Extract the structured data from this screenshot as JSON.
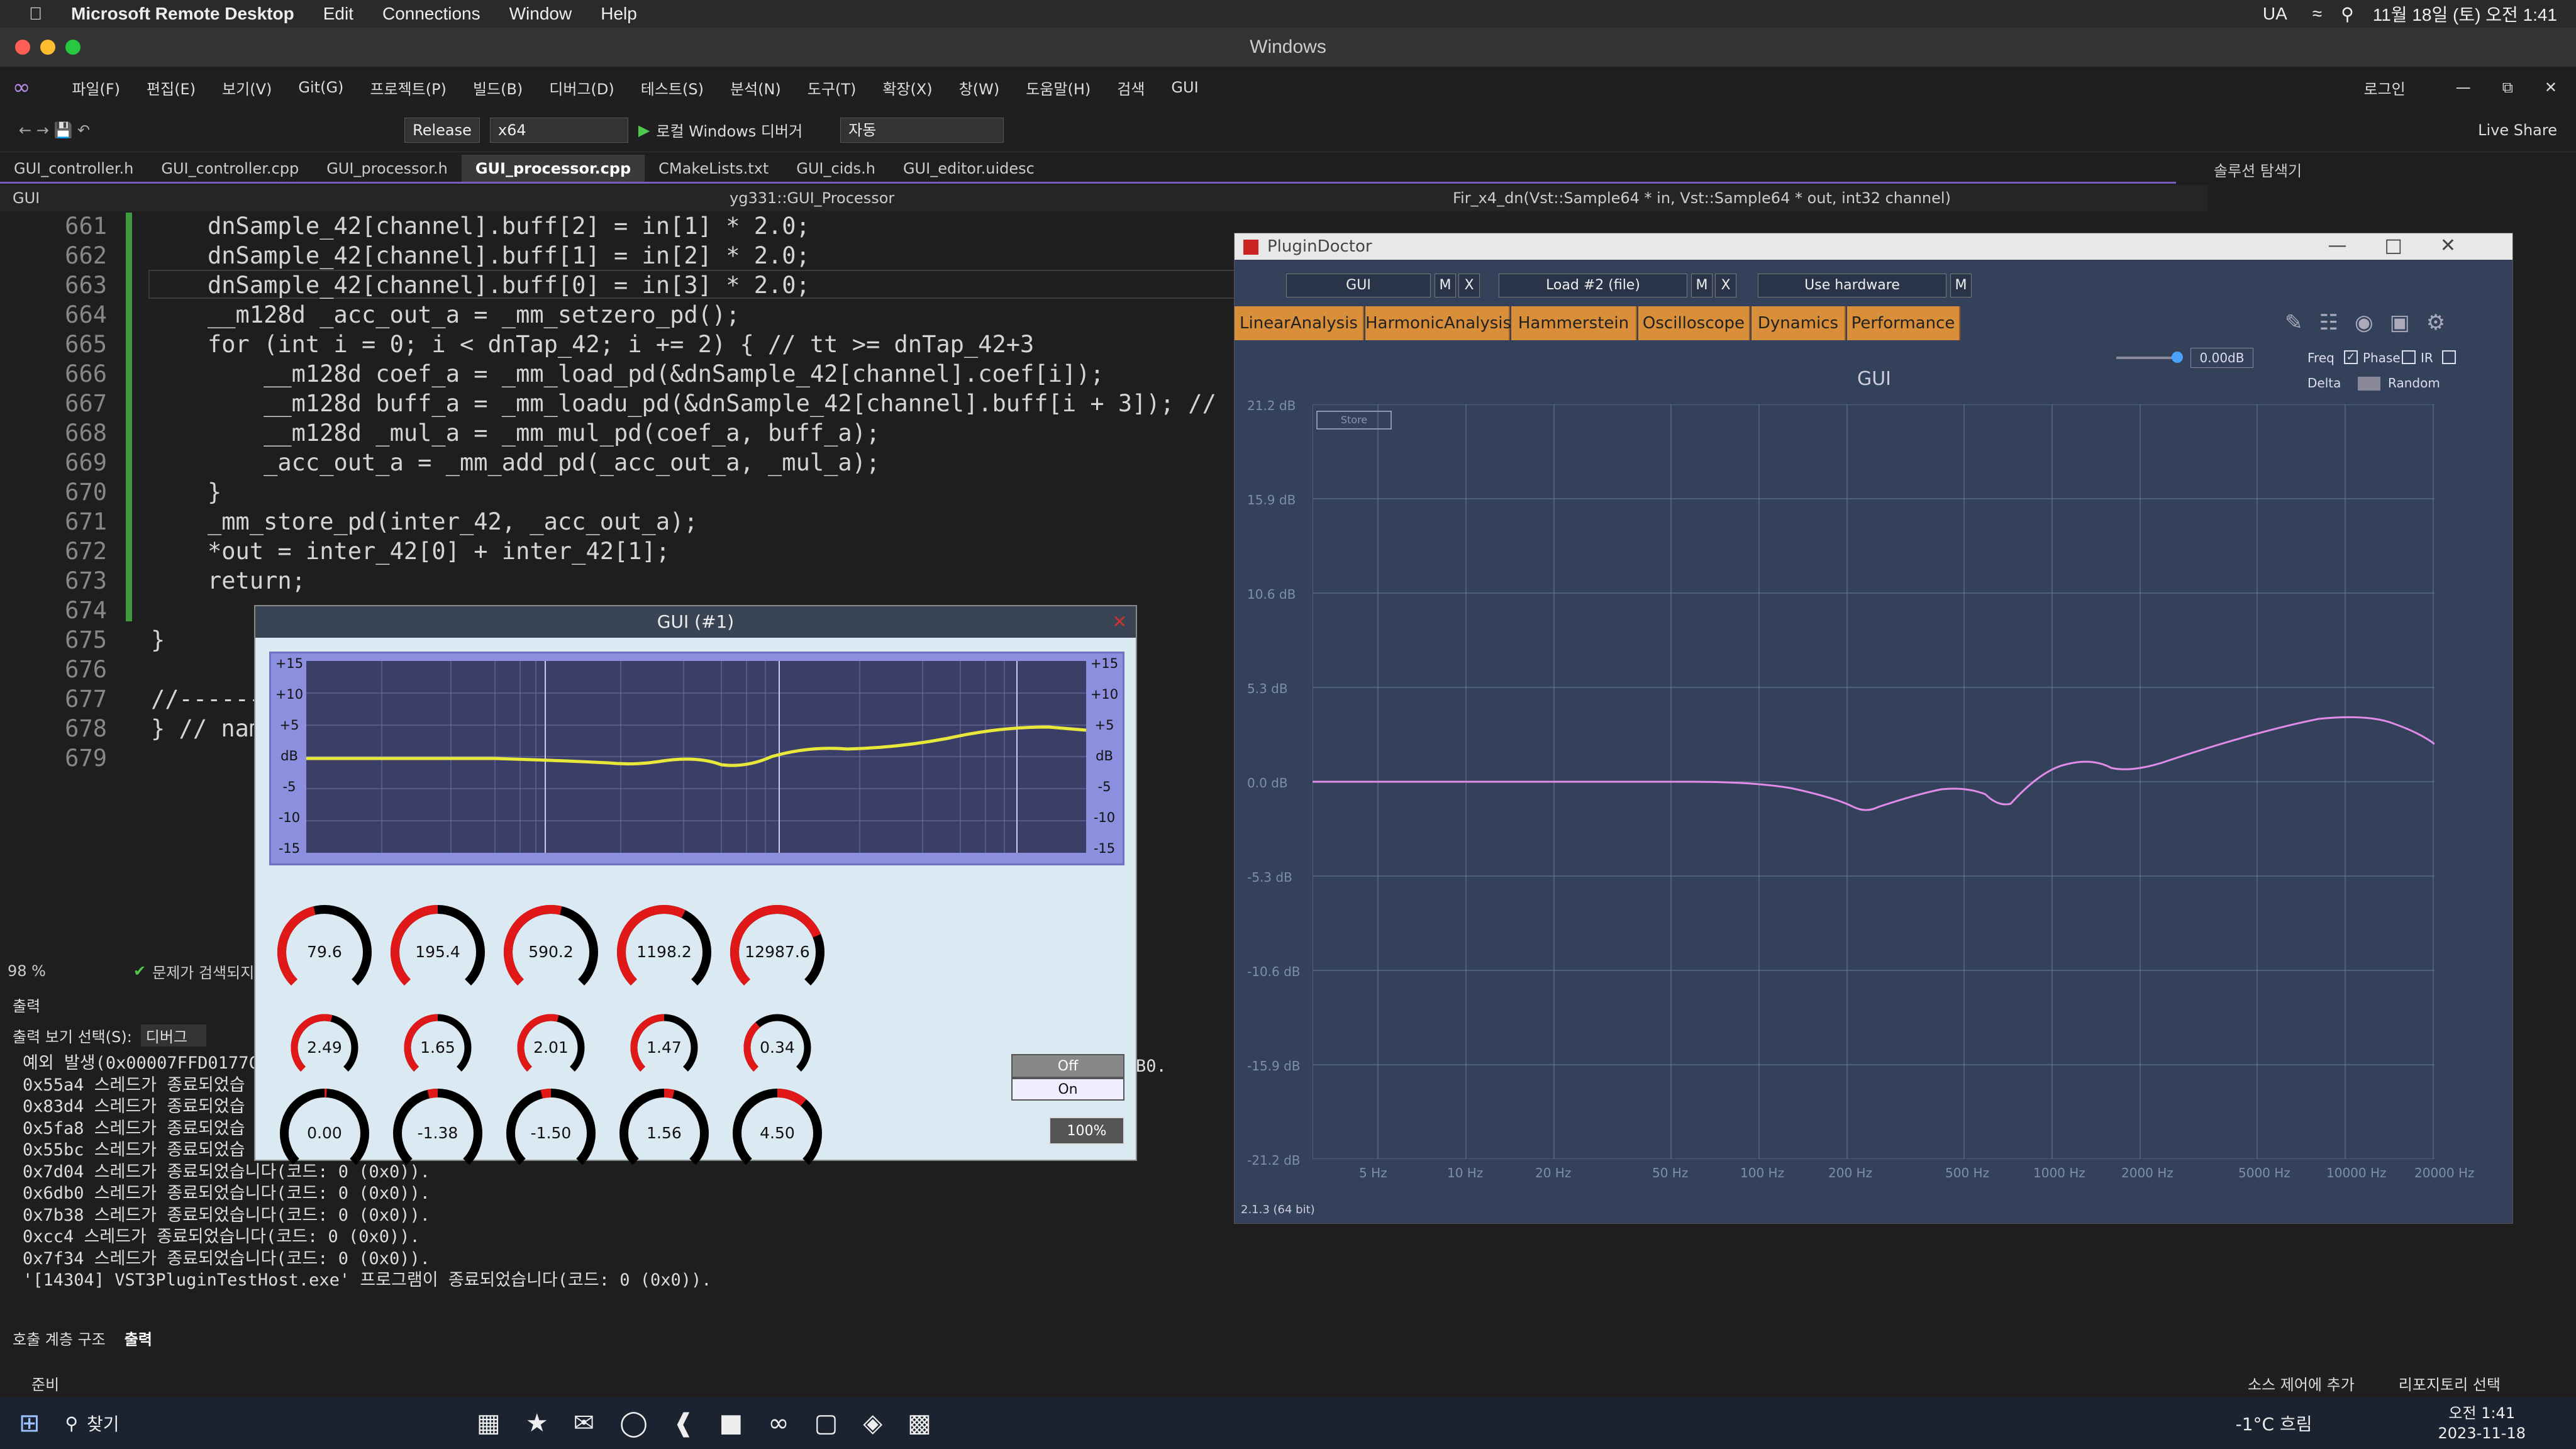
{
  "mac_menu": {
    "app": "Microsoft Remote Desktop",
    "items": [
      "Edit",
      "Connections",
      "Window",
      "Help"
    ],
    "right": [
      "UA",
      "11월 18일 (토) 오전 1:41"
    ]
  },
  "rd_title": "Windows",
  "vs_menu": [
    "파일(F)",
    "편집(E)",
    "보기(V)",
    "Git(G)",
    "프로젝트(P)",
    "빌드(B)",
    "디버그(D)",
    "테스트(S)",
    "분석(N)",
    "도구(T)",
    "확장(X)",
    "창(W)",
    "도움말(H)",
    "검색",
    "GUI"
  ],
  "vs_right": {
    "login": "로그인",
    "liveshare": "Live Share"
  },
  "toolbar": {
    "config": "Release",
    "platform": "x64",
    "debugger": "로컬 Windows 디버거",
    "auto": "자동"
  },
  "tabs": [
    "GUI_controller.h",
    "GUI_controller.cpp",
    "GUI_processor.h",
    "GUI_processor.cpp",
    "CMakeLists.txt",
    "GUI_cids.h",
    "GUI_editor.uidesc"
  ],
  "crumb": {
    "project": "GUI",
    "scope": "yg331::GUI_Processor",
    "func": "Fir_x4_dn(Vst::Sample64 * in, Vst::Sample64 * out, int32 channel)"
  },
  "solution_explorer": "솔루션 탐색기",
  "code_lines": [
    {
      "n": "661",
      "t": "dnSample_42[channel].buff[2] = in[1] * 2.0;"
    },
    {
      "n": "662",
      "t": "dnSample_42[channel].buff[1] = in[2] * 2.0;"
    },
    {
      "n": "663",
      "t": "dnSample_42[channel].buff[0] = in[3] * 2.0;"
    },
    {
      "n": "664",
      "t": "__m128d _acc_out_a = _mm_setzero_pd();"
    },
    {
      "n": "665",
      "t": "for (int i = 0; i < dnTap_42; i += 2) { // tt >= dnTap_42+3"
    },
    {
      "n": "666",
      "t": "    __m128d coef_a = _mm_load_pd(&dnSample_42[channel].coef[i]);"
    },
    {
      "n": "667",
      "t": "    __m128d buff_a = _mm_loadu_pd(&dnSample_42[channel].buff[i + 3]); //"
    },
    {
      "n": "668",
      "t": "    __m128d _mul_a = _mm_mul_pd(coef_a, buff_a);"
    },
    {
      "n": "669",
      "t": "    _acc_out_a = _mm_add_pd(_acc_out_a, _mul_a);"
    },
    {
      "n": "670",
      "t": "}"
    },
    {
      "n": "671",
      "t": "_mm_store_pd(inter_42, _acc_out_a);"
    },
    {
      "n": "672",
      "t": "*out = inter_42[0] + inter_42[1];"
    },
    {
      "n": "673",
      "t": "return;"
    },
    {
      "n": "674",
      "t": ""
    },
    {
      "n": "675",
      "t": "}"
    },
    {
      "n": "676",
      "t": ""
    },
    {
      "n": "677",
      "t": "//------"
    },
    {
      "n": "678",
      "t": "} // nam"
    },
    {
      "n": "679",
      "t": ""
    }
  ],
  "editor_status": {
    "zoom": "98 %",
    "issues": "문제가 검색되지"
  },
  "output": {
    "title": "출력",
    "select_label": "출력 보기 선택(S):",
    "select_value": "디버그",
    "lines": [
      "예외 발생(0x00007FFD0177C",
      "0x55a4 스레드가 종료되었습",
      "0x83d4 스레드가 종료되었습",
      "0x5fa8 스레드가 종료되었습",
      "0x55bc 스레드가 종료되었습",
      "0x7d04 스레드가 종료되었습니다(코드: 0 (0x0)).",
      "0x6db0 스레드가 종료되었습니다(코드: 0 (0x0)).",
      "0x7b38 스레드가 종료되었습니다(코드: 0 (0x0)).",
      "0xcc4 스레드가 종료되었습니다(코드: 0 (0x0)).",
      "0x7f34 스레드가 종료되었습니다(코드: 0 (0x0)).",
      "'[14304] VST3PluginTestHost.exe' 프로그램이 종료되었습니다(코드: 0 (0x0))."
    ],
    "partial": "B0.",
    "tabs": [
      "호출 계층 구조",
      "출력"
    ]
  },
  "vs_status": {
    "ready": "준비",
    "source": "소스 제어에 추가",
    "repo": "리포지토리 선택"
  },
  "taskbar": {
    "search": "찾기",
    "weather": "-1°C 흐림",
    "time": "오전 1:41",
    "date": "2023-11-18"
  },
  "gui_window": {
    "title": "GUI (#1)",
    "db_labels": [
      "+15",
      "+10",
      "+5",
      "dB",
      "-5",
      "-10",
      "-15"
    ],
    "knobs_row1": [
      "79.6",
      "195.4",
      "590.2",
      "1198.2",
      "12987.6"
    ],
    "knobs_row2": [
      "2.49",
      "1.65",
      "2.01",
      "1.47",
      "0.34"
    ],
    "knobs_row3": [
      "0.00",
      "-1.38",
      "-1.50",
      "1.56",
      "4.50"
    ],
    "knob_fill_row1": [
      0.45,
      0.5,
      0.55,
      0.6,
      0.75
    ],
    "knob_fill_row3": [
      0.5,
      0.45,
      0.45,
      0.55,
      0.65
    ],
    "off": "Off",
    "on": "On",
    "zoom": "100%"
  },
  "plugindoctor": {
    "title": "PluginDoctor",
    "plugin": "GUI",
    "load": "Load #2 (file)",
    "hw": "Use hardware",
    "m": "M",
    "x": "X",
    "tabs": [
      "LinearAnalysis",
      "HarmonicAnalysis",
      "Hammerstein",
      "Oscilloscope",
      "Dynamics",
      "Performance"
    ],
    "graph_title": "GUI",
    "gain": "0.00dB",
    "freq": "Freq",
    "phase": "Phase",
    "ir": "IR",
    "delta": "Delta",
    "random": "Random",
    "store": "Store",
    "ylabels": [
      "21.2 dB",
      "15.9 dB",
      "10.6 dB",
      "5.3 dB",
      "0.0 dB",
      "-5.3 dB",
      "-10.6 dB",
      "-15.9 dB",
      "-21.2 dB"
    ],
    "xlabels": [
      "5 Hz",
      "10 Hz",
      "20 Hz",
      "50 Hz",
      "100 Hz",
      "200 Hz",
      "500 Hz",
      "1000 Hz",
      "2000 Hz",
      "5000 Hz",
      "10000 Hz",
      "20000 Hz"
    ],
    "version": "2.1.3 (64 bit)"
  }
}
